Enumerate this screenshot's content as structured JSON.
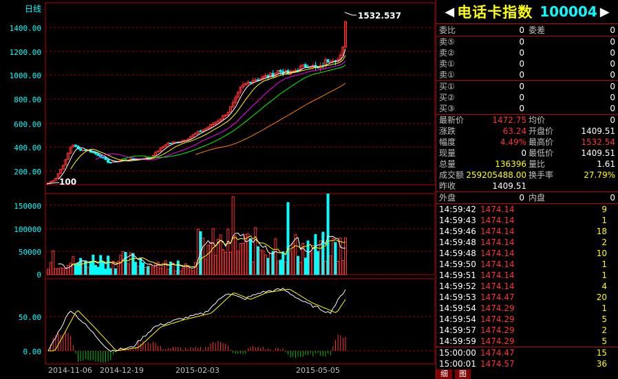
{
  "chart": {
    "period_label": "日线",
    "price_axis": [
      "1400.00",
      "1200.00",
      "1000.00",
      "800.00",
      "600.00",
      "400.00",
      "200.00"
    ],
    "price_high_label": "1532.537",
    "price_low_label": "100",
    "volume_axis": [
      "150000",
      "100000",
      "50000",
      "0"
    ],
    "indicator_axis": [
      "50.00",
      "0.00"
    ],
    "dates": [
      "2014-11-06",
      "2014-12-19",
      "2015-02-03",
      "2015-05-05"
    ],
    "colors": {
      "up": "#ff3232",
      "down": "#00ffff",
      "ma5": "#ffffff",
      "ma10": "#ffff00",
      "ma20": "#ff00ff",
      "ma30": "#00ff00",
      "ma60": "#ff8000",
      "grid": "#a00000"
    }
  },
  "stock": {
    "name": "电话卡指数",
    "code": "100004",
    "prev_arrow": "◀",
    "next_arrow": "▶"
  },
  "commission": {
    "ratio_label": "委比",
    "ratio_value": "0",
    "diff_label": "委差",
    "diff_value": "0"
  },
  "asks": [
    {
      "label": "卖⑤",
      "price": "0",
      "volume": "0"
    },
    {
      "label": "卖②",
      "price": "0",
      "volume": "0"
    },
    {
      "label": "卖①",
      "price": "0",
      "volume": "0"
    },
    {
      "label": "卖①",
      "price": "0",
      "volume": "0"
    }
  ],
  "bids": [
    {
      "label": "买①",
      "price": "0",
      "volume": "0"
    },
    {
      "label": "买②",
      "price": "0",
      "volume": "0"
    },
    {
      "label": "买③",
      "price": "0",
      "volume": "0"
    }
  ],
  "quote": {
    "last_label": "最新价",
    "last_value": "1472.75",
    "avg_label": "均价",
    "avg_value": "0",
    "change_label": "涨跌",
    "change_value": "63.24",
    "open_label": "开盘价",
    "open_value": "1409.51",
    "pct_label": "幅度",
    "pct_value": "4.49%",
    "high_label": "最高价",
    "high_value": "1532.54",
    "vol_now_label": "现量",
    "vol_now_value": "0",
    "low_label": "最低价",
    "low_value": "1409.51",
    "total_label": "总量",
    "total_value": "136396",
    "vr_label": "量比",
    "vr_value": "1.61",
    "amount_label": "成交额",
    "amount_value": "259205488.00",
    "turnover_label": "换手率",
    "turnover_value": "27.79%",
    "prev_close_label": "昨收",
    "prev_close_value": "1409.51"
  },
  "flow": {
    "outer_label": "外盘",
    "outer_value": "0",
    "inner_label": "内盘",
    "inner_value": "0"
  },
  "trades": [
    {
      "time": "14:59:42",
      "price": "1474.14",
      "vol": "9"
    },
    {
      "time": "14:59:43",
      "price": "1474.14",
      "vol": "1"
    },
    {
      "time": "14:59:46",
      "price": "1474.14",
      "vol": "18"
    },
    {
      "time": "14:59:48",
      "price": "1474.14",
      "vol": "2"
    },
    {
      "time": "14:59:48",
      "price": "1474.14",
      "vol": "10"
    },
    {
      "time": "14:59:50",
      "price": "1474.14",
      "vol": "1"
    },
    {
      "time": "14:59:51",
      "price": "1474.14",
      "vol": "1"
    },
    {
      "time": "14:59:52",
      "price": "1474.14",
      "vol": "4"
    },
    {
      "time": "14:59:53",
      "price": "1474.47",
      "vol": "20"
    },
    {
      "time": "14:59:54",
      "price": "1474.29",
      "vol": "1"
    },
    {
      "time": "14:59:54",
      "price": "1474.29",
      "vol": "5"
    },
    {
      "time": "14:59:57",
      "price": "1474.29",
      "vol": "2"
    },
    {
      "time": "14:59:59",
      "price": "1474.29",
      "vol": "5"
    },
    {
      "time": "15:00:00",
      "price": "1474.47",
      "vol": "15"
    },
    {
      "time": "15:00:01",
      "price": "1474.57",
      "vol": "36"
    }
  ],
  "tabs": [
    "细",
    "图"
  ]
}
